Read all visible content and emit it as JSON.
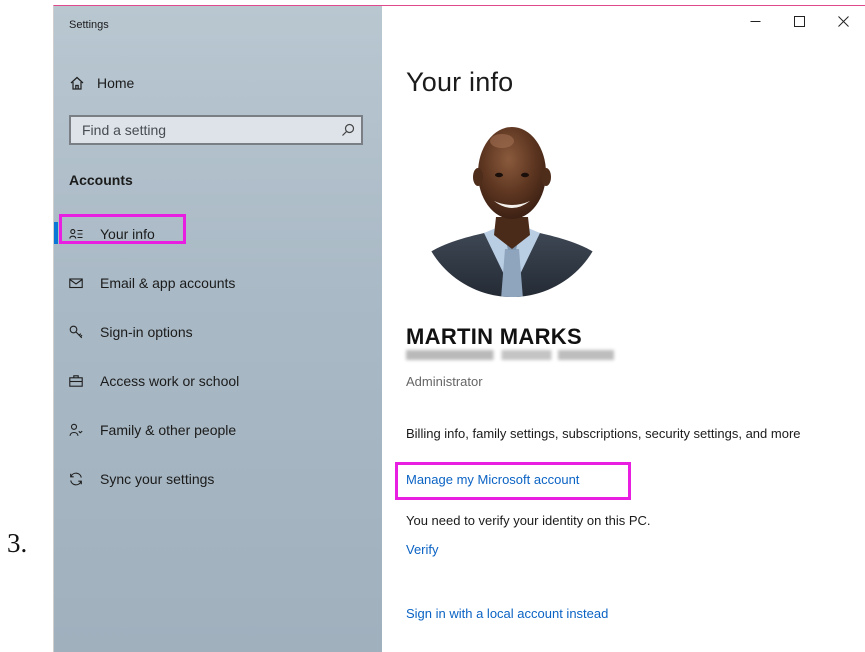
{
  "step_number": "3.",
  "window": {
    "title": "Settings",
    "controls": {
      "minimize": "–",
      "maximize": "☐",
      "close": "✕"
    }
  },
  "sidebar": {
    "home": {
      "icon": "home-icon",
      "label": "Home"
    },
    "search": {
      "placeholder": "Find a setting",
      "value": "",
      "icon": "search-icon"
    },
    "section_title": "Accounts",
    "items": [
      {
        "icon": "person-card-icon",
        "label": "Your info",
        "selected": true
      },
      {
        "icon": "mail-icon",
        "label": "Email & app accounts"
      },
      {
        "icon": "key-icon",
        "label": "Sign-in options"
      },
      {
        "icon": "briefcase-icon",
        "label": "Access work or school"
      },
      {
        "icon": "people-icon",
        "label": "Family & other people"
      },
      {
        "icon": "sync-icon",
        "label": "Sync your settings"
      }
    ]
  },
  "main": {
    "title": "Your info",
    "profile": {
      "name": "MARTIN MARKS",
      "email": "",
      "role": "Administrator"
    },
    "billing_text": "Billing info, family settings, subscriptions, security settings, and more",
    "manage_link": "Manage my Microsoft account",
    "verify_text": "You need to verify your identity on this PC.",
    "verify_link": "Verify",
    "local_account_link": "Sign in with a local account instead"
  },
  "colors": {
    "accent": "#0a76d6",
    "link": "#0b63c4",
    "annotation_highlight": "#e81fe0",
    "sidebar_bg": "#a9b9c5"
  }
}
